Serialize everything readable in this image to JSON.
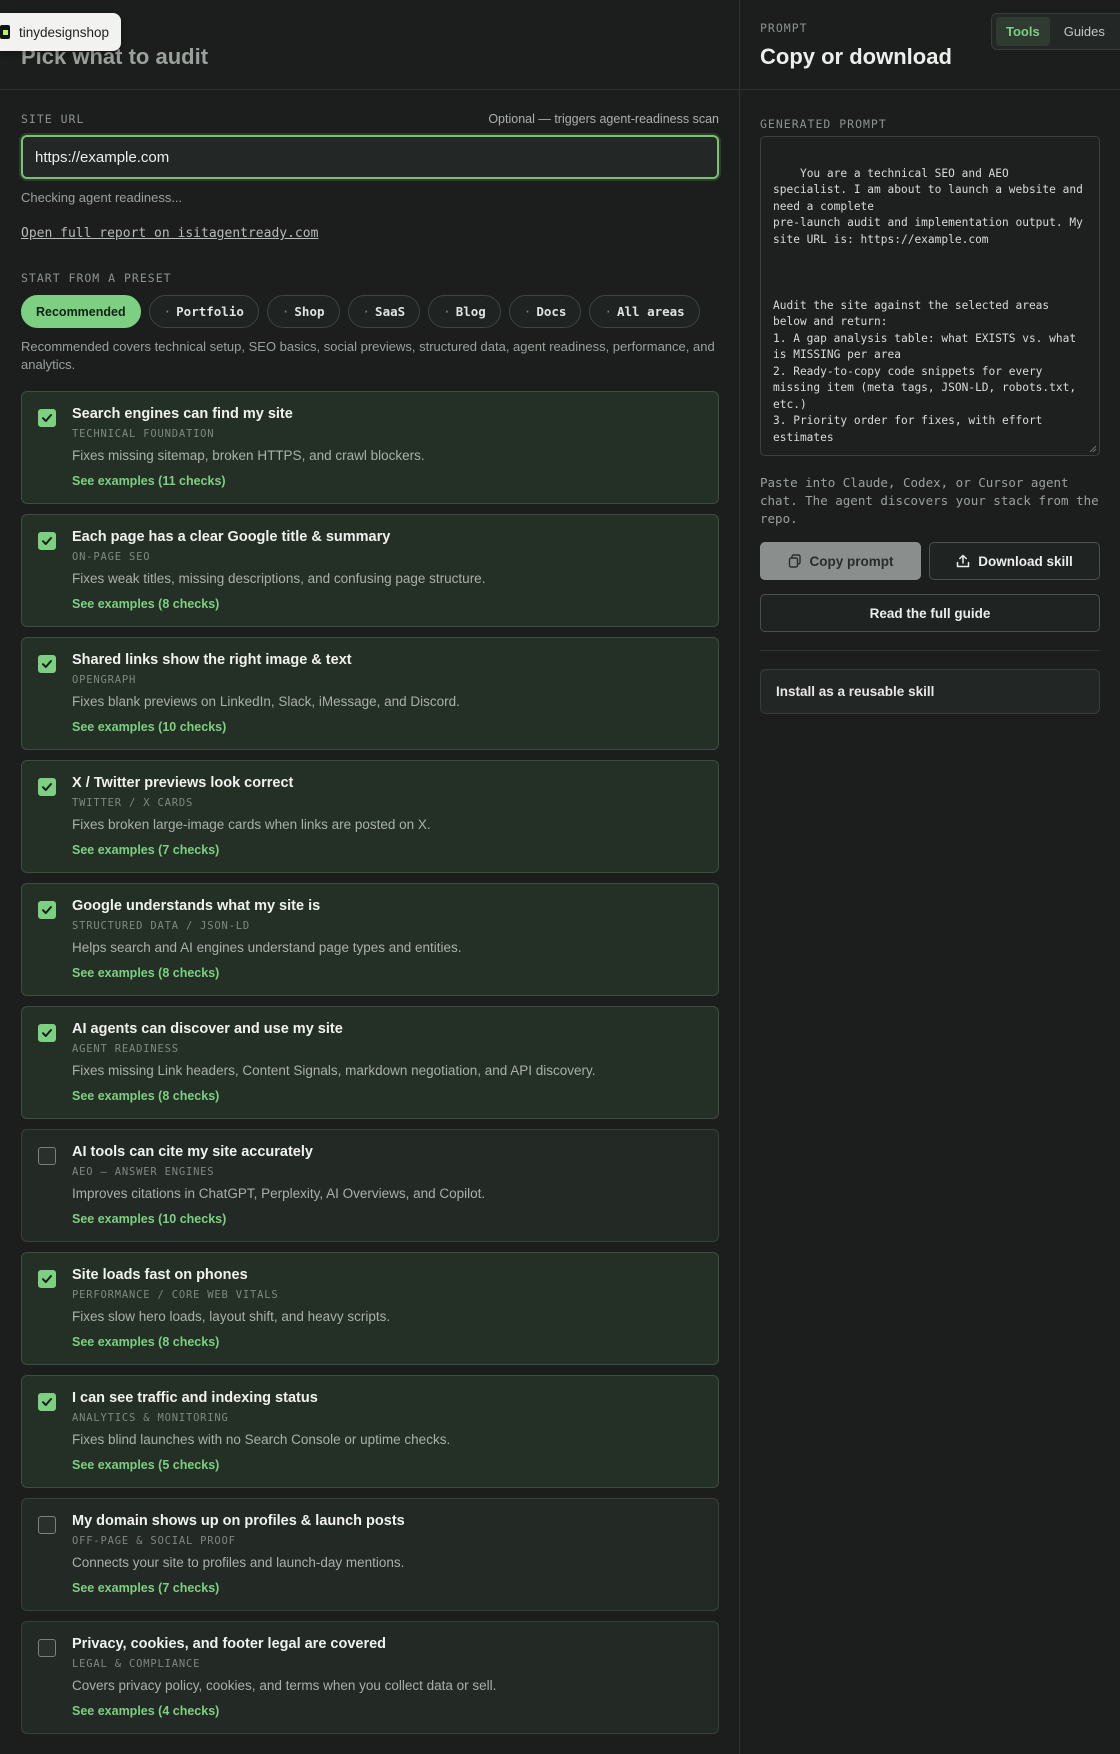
{
  "brand": {
    "name": "tinydesignshop"
  },
  "left": {
    "title": "Pick what to audit",
    "site_url_label": "SITE URL",
    "site_url_hint": "Optional — triggers agent-readiness scan",
    "site_url_value": "https://example.com",
    "status": "Checking agent readiness...",
    "report_link": "Open full report on isitagentready.com",
    "preset_label": "START FROM A PRESET",
    "presets": [
      {
        "label": "Recommended",
        "active": true
      },
      {
        "label": "Portfolio",
        "active": false
      },
      {
        "label": "Shop",
        "active": false
      },
      {
        "label": "SaaS",
        "active": false
      },
      {
        "label": "Blog",
        "active": false
      },
      {
        "label": "Docs",
        "active": false
      },
      {
        "label": "All areas",
        "active": false
      }
    ],
    "preset_bullet": "·",
    "preset_description": "Recommended covers technical setup, SEO basics, social previews, structured data, agent readiness, performance, and analytics.",
    "areas": [
      {
        "title": "Search engines can find my site",
        "subtitle": "TECHNICAL FOUNDATION",
        "description": "Fixes missing sitemap, broken HTTPS, and crawl blockers.",
        "examples": "See examples (11 checks)",
        "checked": true
      },
      {
        "title": "Each page has a clear Google title & summary",
        "subtitle": "ON-PAGE SEO",
        "description": "Fixes weak titles, missing descriptions, and confusing page structure.",
        "examples": "See examples (8 checks)",
        "checked": true
      },
      {
        "title": "Shared links show the right image & text",
        "subtitle": "OPENGRAPH",
        "description": "Fixes blank previews on LinkedIn, Slack, iMessage, and Discord.",
        "examples": "See examples (10 checks)",
        "checked": true
      },
      {
        "title": "X / Twitter previews look correct",
        "subtitle": "TWITTER / X CARDS",
        "description": "Fixes broken large-image cards when links are posted on X.",
        "examples": "See examples (7 checks)",
        "checked": true
      },
      {
        "title": "Google understands what my site is",
        "subtitle": "STRUCTURED DATA / JSON-LD",
        "description": "Helps search and AI engines understand page types and entities.",
        "examples": "See examples (8 checks)",
        "checked": true
      },
      {
        "title": "AI agents can discover and use my site",
        "subtitle": "AGENT READINESS",
        "description": "Fixes missing Link headers, Content Signals, markdown negotiation, and API discovery.",
        "examples": "See examples (8 checks)",
        "checked": true
      },
      {
        "title": "AI tools can cite my site accurately",
        "subtitle": "AEO — ANSWER ENGINES",
        "description": "Improves citations in ChatGPT, Perplexity, AI Overviews, and Copilot.",
        "examples": "See examples (10 checks)",
        "checked": false
      },
      {
        "title": "Site loads fast on phones",
        "subtitle": "PERFORMANCE / CORE WEB VITALS",
        "description": "Fixes slow hero loads, layout shift, and heavy scripts.",
        "examples": "See examples (8 checks)",
        "checked": true
      },
      {
        "title": "I can see traffic and indexing status",
        "subtitle": "ANALYTICS & MONITORING",
        "description": "Fixes blind launches with no Search Console or uptime checks.",
        "examples": "See examples (5 checks)",
        "checked": true
      },
      {
        "title": "My domain shows up on profiles & launch posts",
        "subtitle": "OFF-PAGE & SOCIAL PROOF",
        "description": "Connects your site to profiles and launch-day mentions.",
        "examples": "See examples (7 checks)",
        "checked": false
      },
      {
        "title": "Privacy, cookies, and footer legal are covered",
        "subtitle": "LEGAL & COMPLIANCE",
        "description": "Covers privacy policy, cookies, and terms when you collect data or sell.",
        "examples": "See examples (4 checks)",
        "checked": false
      }
    ]
  },
  "right": {
    "section_label": "PROMPT",
    "title": "Copy or download",
    "nav": {
      "tabs": [
        "Tools",
        "Guides"
      ],
      "active": "Tools",
      "more": "S"
    },
    "generated_label": "GENERATED PROMPT",
    "prompt_text": "You are a technical SEO and AEO specialist. I am about to launch a website and need a complete\npre-launch audit and implementation output. My site URL is: https://example.com\n\n\n\nAudit the site against the selected areas below and return:\n1. A gap analysis table: what EXISTS vs. what is MISSING per area\n2. Ready-to-copy code snippets for every missing item (meta tags, JSON-LD, robots.txt, etc.)\n3. Priority order for fixes, with effort estimates\n\nUser context: The person sharing this prompt",
    "paste_note": "Paste into Claude, Codex, or Cursor agent chat. The agent discovers your stack from the repo.",
    "copy_label": "Copy prompt",
    "download_label": "Download skill",
    "guide_label": "Read the full guide",
    "install_label": "Install as a reusable skill"
  },
  "colors": {
    "accent": "#7dcf81",
    "background": "#1b1e1d"
  }
}
